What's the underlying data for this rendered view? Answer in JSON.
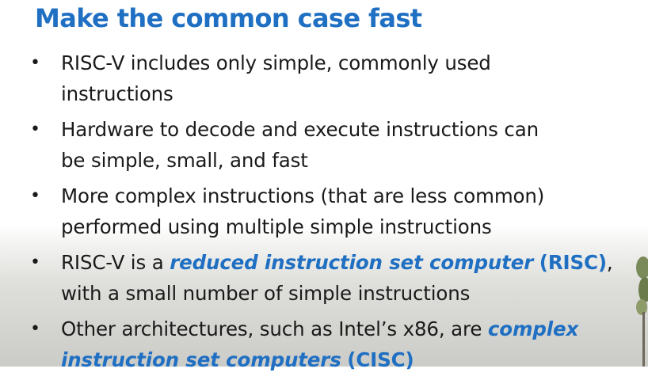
{
  "slide": {
    "title": "Make the common case fast",
    "bullet_glyph": "•",
    "bullets": [
      {
        "line1": "RISC-V includes only simple, commonly used",
        "line2": "instructions"
      },
      {
        "line1": "Hardware to decode and execute instructions can",
        "line2": "be simple, small, and fast"
      },
      {
        "line1": "More complex instructions (that are less common)",
        "line2": "performed using multiple simple instructions"
      },
      {
        "prefix": "RISC-V is a ",
        "term": "reduced instruction set computer",
        "sep": " ",
        "abbr": "(RISC)",
        "suffix": ",",
        "line2": "with a small number of simple instructions"
      },
      {
        "prefix": "Other architectures, such as Intel’s x86, are ",
        "term_part1": "complex",
        "term_part2": "instruction set computers",
        "sep": " ",
        "abbr": "(CISC)"
      }
    ]
  },
  "colors": {
    "accent": "#1f6fc2",
    "text": "#1a1a1a"
  }
}
